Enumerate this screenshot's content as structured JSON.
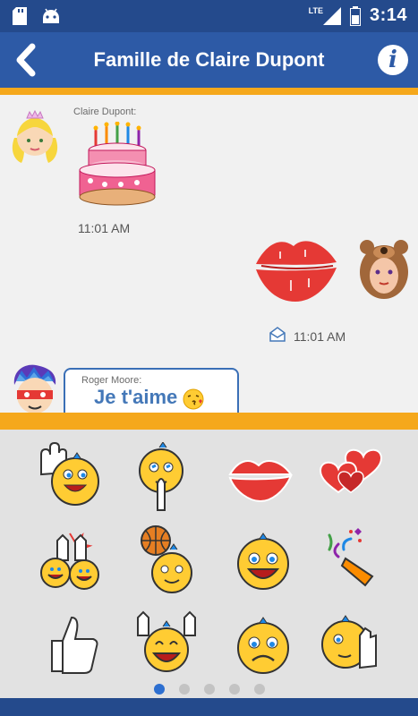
{
  "status_bar": {
    "network_label": "LTE",
    "time": "3:14",
    "icons": [
      "sd-card-icon",
      "android-icon",
      "signal-icon",
      "battery-icon"
    ]
  },
  "header": {
    "title": "Famille de Claire Dupont",
    "back_icon": "back-arrow-icon",
    "info_label": "i"
  },
  "colors": {
    "header_blue": "#2d5aa6",
    "status_blue": "#244a8c",
    "accent_orange": "#f5a81c",
    "bubble_text_blue": "#4478b8"
  },
  "chat": {
    "messages": [
      {
        "sender": "Claire Dupont:",
        "sticker": "birthday-cake-sticker",
        "time": "11:01 AM",
        "side": "left"
      },
      {
        "sender": "",
        "sticker": "kiss-lips-sticker",
        "time": "11:01 AM",
        "side": "right",
        "status_icon": "read-envelope-icon"
      },
      {
        "sender": "Roger Moore:",
        "text": "Je t'aime",
        "text_emoji": "kiss-face-emoji",
        "side": "left"
      }
    ]
  },
  "stickers": {
    "rows": [
      [
        "waving-smiley-sticker",
        "praying-smiley-sticker",
        "red-lips-sticker",
        "hearts-sticker"
      ],
      [
        "high-five-sticker",
        "basketball-smiley-sticker",
        "laughing-smiley-sticker",
        "party-horn-sticker"
      ],
      [
        "thumbs-up-sticker",
        "cheering-smiley-sticker",
        "sad-smiley-sticker",
        "facepalm-smiley-sticker"
      ]
    ],
    "pages": 5,
    "current_page": 1
  }
}
